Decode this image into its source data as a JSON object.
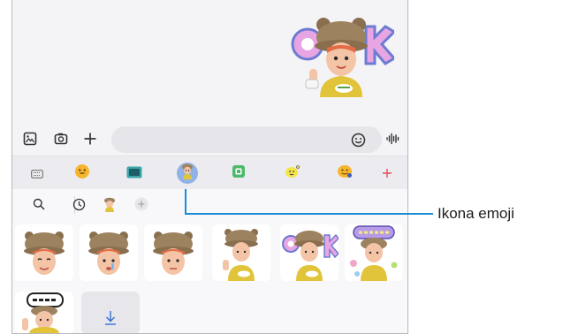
{
  "composer": {
    "gallery_icon": "gallery-icon",
    "camera_icon": "camera-icon",
    "add_icon": "plus-icon",
    "emoji_button_icon": "smiley-icon",
    "voice_icon": "voice-waveform-icon"
  },
  "emoji_tabs": [
    {
      "name": "keyboard-tab",
      "icon": "keyboard-icon"
    },
    {
      "name": "emoji-tab",
      "icon": "smiley-emoji-icon"
    },
    {
      "name": "gif-tab",
      "icon": "gif-icon"
    },
    {
      "name": "ar-emoji-tab",
      "icon": "ar-emoji-avatar-icon",
      "selected": true
    },
    {
      "name": "sticker-tab",
      "icon": "sticker-icon"
    },
    {
      "name": "bitmoji-tab",
      "icon": "bitmoji-icon"
    },
    {
      "name": "live-message-tab",
      "icon": "live-emoji-icon"
    },
    {
      "name": "add-tab",
      "icon": "plus-icon"
    }
  ],
  "sticker_panel": {
    "tools": [
      "search-icon",
      "recent-clock-icon",
      "avatar-icon",
      "add-icon"
    ],
    "stickers": [
      {
        "name": "sticker-bear-hat-1"
      },
      {
        "name": "sticker-bear-hat-2"
      },
      {
        "name": "sticker-bear-hat-3"
      },
      {
        "name": "sticker-bear-hat-4"
      },
      {
        "name": "sticker-ok"
      },
      {
        "name": "sticker-thanks"
      },
      {
        "name": "sticker-sorry"
      },
      {
        "name": "sticker-download"
      }
    ]
  },
  "sent_message": {
    "sticker": "ok-sticker",
    "timestamp_text": ""
  },
  "callout": {
    "label": "Ikona emoji"
  },
  "colors": {
    "accent": "#1a8bd6",
    "selected_tab": "#8fb3e6",
    "add_red": "#e64a57"
  }
}
